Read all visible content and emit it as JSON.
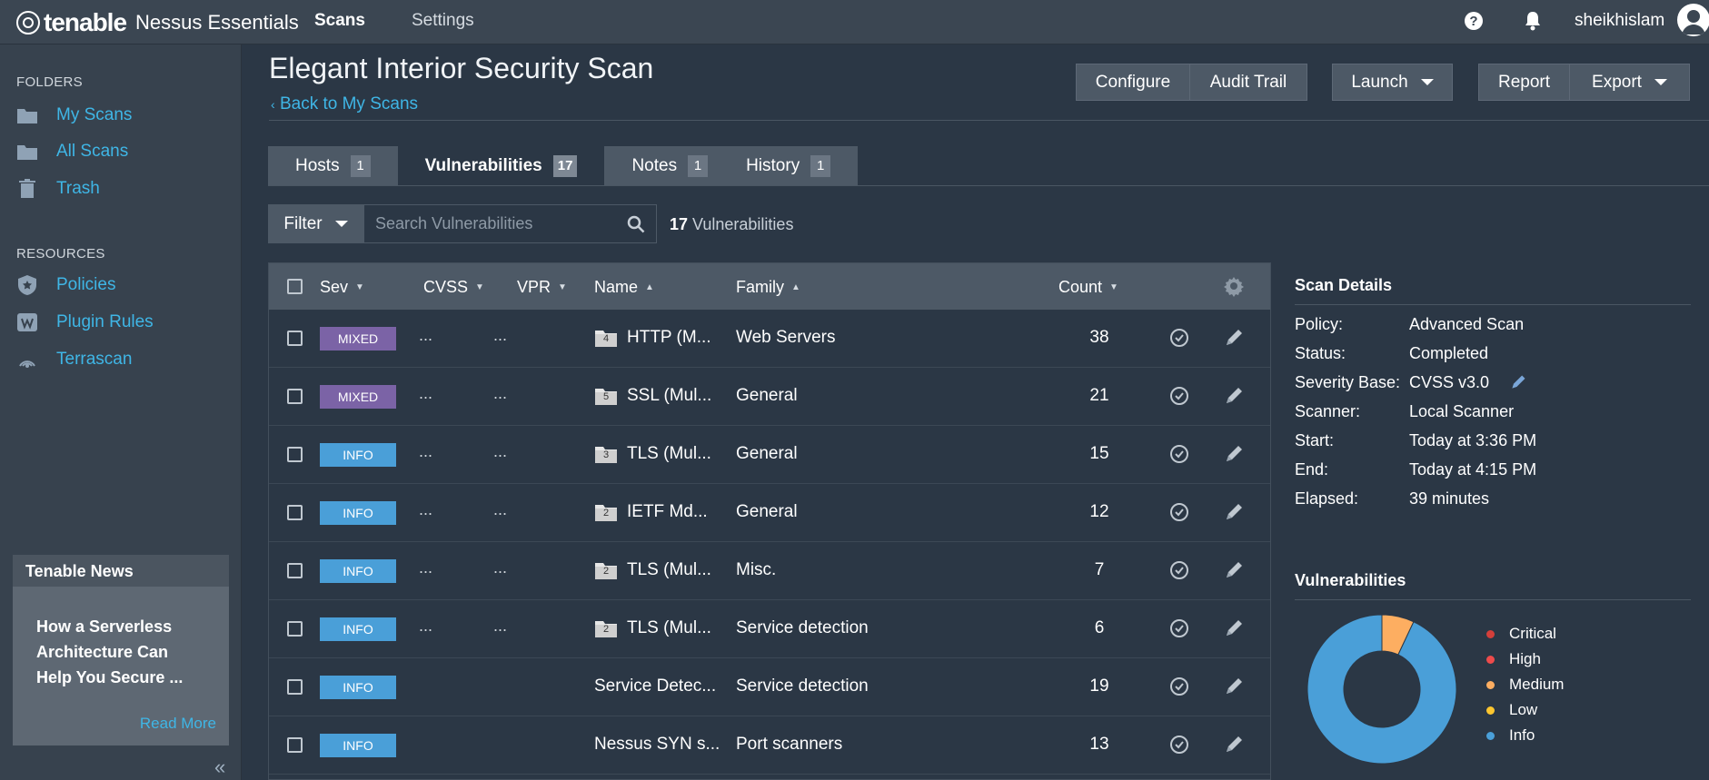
{
  "topbar": {
    "brand": "tenable",
    "product": "Nessus Essentials",
    "nav": [
      "Scans",
      "Settings"
    ],
    "user": "sheikhislam"
  },
  "sidebar": {
    "folders_heading": "FOLDERS",
    "folders": [
      "My Scans",
      "All Scans",
      "Trash"
    ],
    "resources_heading": "RESOURCES",
    "resources": [
      "Policies",
      "Plugin Rules",
      "Terrascan"
    ],
    "news_title": "Tenable News",
    "news_body": "How a Serverless Architecture Can Help You Secure ...",
    "news_link": "Read More",
    "collapse_icon": "«"
  },
  "header": {
    "title": "Elegant Interior Security Scan",
    "back": "Back to My Scans",
    "buttons": {
      "configure": "Configure",
      "audit": "Audit Trail",
      "launch": "Launch",
      "report": "Report",
      "export": "Export"
    }
  },
  "tabs": [
    {
      "label": "Hosts",
      "count": "1"
    },
    {
      "label": "Vulnerabilities",
      "count": "17"
    },
    {
      "label": "Notes",
      "count": "1"
    },
    {
      "label": "History",
      "count": "1"
    }
  ],
  "filter": {
    "label": "Filter",
    "placeholder": "Search Vulnerabilities",
    "count": "17",
    "count_suffix": "Vulnerabilities"
  },
  "table": {
    "columns": [
      "Sev",
      "CVSS",
      "VPR",
      "Name",
      "Family",
      "Count"
    ],
    "rows": [
      {
        "sev": "MIXED",
        "cvss": "...",
        "vpr": "...",
        "folder": "4",
        "name": "HTTP (M...",
        "family": "Web Servers",
        "count": "38"
      },
      {
        "sev": "MIXED",
        "cvss": "...",
        "vpr": "...",
        "folder": "5",
        "name": "SSL (Mul...",
        "family": "General",
        "count": "21"
      },
      {
        "sev": "INFO",
        "cvss": "...",
        "vpr": "...",
        "folder": "3",
        "name": "TLS (Mul...",
        "family": "General",
        "count": "15"
      },
      {
        "sev": "INFO",
        "cvss": "...",
        "vpr": "...",
        "folder": "2",
        "name": "IETF Md...",
        "family": "General",
        "count": "12"
      },
      {
        "sev": "INFO",
        "cvss": "...",
        "vpr": "...",
        "folder": "2",
        "name": "TLS (Mul...",
        "family": "Misc.",
        "count": "7"
      },
      {
        "sev": "INFO",
        "cvss": "...",
        "vpr": "...",
        "folder": "2",
        "name": "TLS (Mul...",
        "family": "Service detection",
        "count": "6"
      },
      {
        "sev": "INFO",
        "cvss": "",
        "vpr": "",
        "folder": "",
        "name": "Service Detec...",
        "family": "Service detection",
        "count": "19"
      },
      {
        "sev": "INFO",
        "cvss": "",
        "vpr": "",
        "folder": "",
        "name": "Nessus SYN s...",
        "family": "Port scanners",
        "count": "13"
      }
    ]
  },
  "details": {
    "title": "Scan Details",
    "rows": [
      {
        "key": "Policy:",
        "val": "Advanced Scan"
      },
      {
        "key": "Status:",
        "val": "Completed"
      },
      {
        "key": "Severity Base:",
        "val": "CVSS v3.0"
      },
      {
        "key": "Scanner:",
        "val": "Local Scanner"
      },
      {
        "key": "Start:",
        "val": "Today at 3:36 PM"
      },
      {
        "key": "End:",
        "val": "Today at 4:15 PM"
      },
      {
        "key": "Elapsed:",
        "val": "39 minutes"
      }
    ]
  },
  "vulnerabilities": {
    "title": "Vulnerabilities",
    "legend": [
      {
        "label": "Critical",
        "color": "#d43f3a"
      },
      {
        "label": "High",
        "color": "#ee4b4b"
      },
      {
        "label": "Medium",
        "color": "#fdae61"
      },
      {
        "label": "Low",
        "color": "#fdc62f"
      },
      {
        "label": "Info",
        "color": "#4a9fd8"
      }
    ],
    "distribution": {
      "Critical": 0,
      "High": 0,
      "Medium": 0.07,
      "Low": 0,
      "Info": 0.93
    }
  },
  "colors": {
    "mixed": "#7b63a6",
    "info": "#4a9fd8",
    "link": "#3fb6e6"
  }
}
